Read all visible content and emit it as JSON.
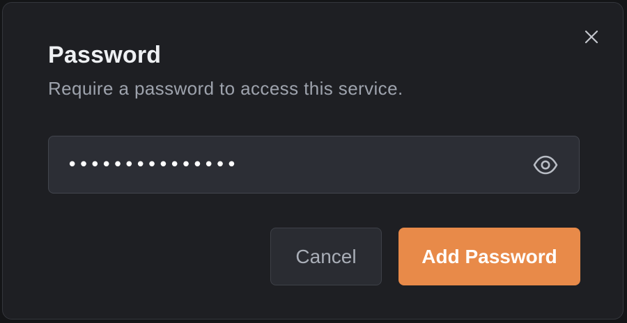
{
  "dialog": {
    "title": "Password",
    "subtitle": "Require a password to access this service.",
    "close_icon": "close-icon"
  },
  "password_field": {
    "value": "•••••••••••••••",
    "toggle_icon": "eye-icon"
  },
  "actions": {
    "cancel_label": "Cancel",
    "submit_label": "Add Password"
  },
  "colors": {
    "accent": "#e88a49",
    "background": "#1e1f23",
    "input_background": "#2c2e35"
  }
}
